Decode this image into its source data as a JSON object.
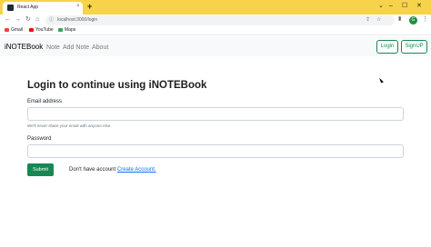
{
  "browser": {
    "tab_title": "React App",
    "tab_close": "×",
    "new_tab": "+",
    "window_controls": [
      "⌄",
      "–",
      "☐",
      "✕"
    ],
    "nav_icons": [
      "←",
      "→",
      "↻",
      "⌂"
    ],
    "url": "localhost:3000/login",
    "profile_initial": "G",
    "bookmarks": [
      "Gmail",
      "YouTube",
      "Maps"
    ]
  },
  "navbar": {
    "brand": "iNOTEBook",
    "links": [
      "Note",
      "Add Note",
      "About"
    ],
    "login_label": "Login",
    "signup_label": "SignUP"
  },
  "main": {
    "heading": "Login to continue using iNOTEBook",
    "email_label": "Email address",
    "email_value": "",
    "email_help": "We'll never share your email with anyone else.",
    "password_label": "Password",
    "password_value": "",
    "submit_label": "Submit",
    "account_prefix": "Don't have account",
    "account_link": "Create Account."
  },
  "colors": {
    "tabbar": "#f6d34a",
    "primary_green": "#198754",
    "link_blue": "#0d6efd"
  }
}
